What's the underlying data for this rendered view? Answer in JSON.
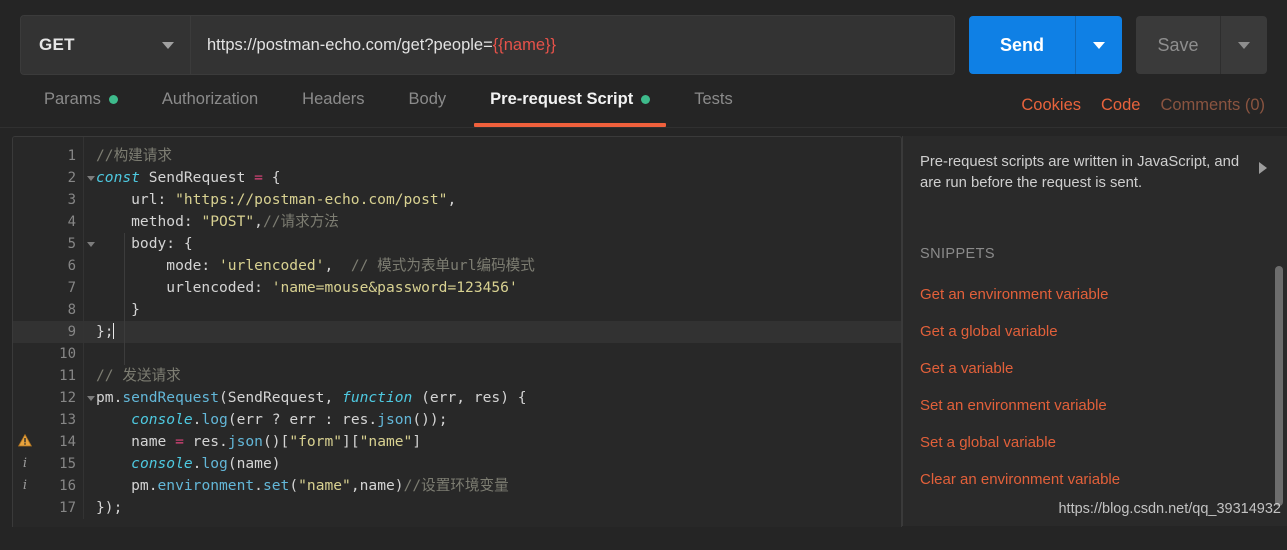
{
  "request": {
    "method": "GET",
    "url_prefix": "https://postman-echo.com/get?people=",
    "url_variable": "{{name}}",
    "send_label": "Send",
    "save_label": "Save"
  },
  "tabs": [
    {
      "label": "Params",
      "dot": true,
      "active": false
    },
    {
      "label": "Authorization",
      "dot": false,
      "active": false
    },
    {
      "label": "Headers",
      "dot": false,
      "active": false
    },
    {
      "label": "Body",
      "dot": false,
      "active": false
    },
    {
      "label": "Pre-request Script",
      "dot": true,
      "active": true
    },
    {
      "label": "Tests",
      "dot": false,
      "active": false
    }
  ],
  "tab_actions": [
    {
      "label": "Cookies",
      "muted": false
    },
    {
      "label": "Code",
      "muted": false
    },
    {
      "label": "Comments (0)",
      "muted": true
    }
  ],
  "editor": {
    "lines": [
      {
        "n": "1",
        "marker": "",
        "fold": false,
        "current": false
      },
      {
        "n": "2",
        "marker": "",
        "fold": true,
        "current": false
      },
      {
        "n": "3",
        "marker": "",
        "fold": false,
        "current": false
      },
      {
        "n": "4",
        "marker": "",
        "fold": false,
        "current": false
      },
      {
        "n": "5",
        "marker": "",
        "fold": true,
        "current": false
      },
      {
        "n": "6",
        "marker": "",
        "fold": false,
        "current": false
      },
      {
        "n": "7",
        "marker": "",
        "fold": false,
        "current": false
      },
      {
        "n": "8",
        "marker": "",
        "fold": false,
        "current": false
      },
      {
        "n": "9",
        "marker": "",
        "fold": false,
        "current": true
      },
      {
        "n": "10",
        "marker": "",
        "fold": false,
        "current": false
      },
      {
        "n": "11",
        "marker": "",
        "fold": false,
        "current": false
      },
      {
        "n": "12",
        "marker": "",
        "fold": true,
        "current": false
      },
      {
        "n": "13",
        "marker": "",
        "fold": false,
        "current": false
      },
      {
        "n": "14",
        "marker": "warning",
        "fold": false,
        "current": false
      },
      {
        "n": "15",
        "marker": "info",
        "fold": false,
        "current": false
      },
      {
        "n": "16",
        "marker": "info",
        "fold": false,
        "current": false
      },
      {
        "n": "17",
        "marker": "",
        "fold": false,
        "current": false
      }
    ],
    "code_text": [
      "//构建请求",
      "const SendRequest = {",
      "    url: \"https://postman-echo.com/post\",",
      "    method: \"POST\",//请求方法",
      "    body: {",
      "        mode: 'urlencoded',  // 模式为表单url编码模式",
      "        urlencoded: 'name=mouse&password=123456'",
      "    }",
      "};",
      "",
      "// 发送请求",
      "pm.sendRequest(SendRequest, function (err, res) {",
      "    console.log(err ? err : res.json());",
      "    name = res.json()[\"form\"][\"name\"]",
      "    console.log(name)",
      "    pm.environment.set(\"name\",name)//设置环境变量",
      "});"
    ]
  },
  "side_panel": {
    "description": "Pre-request scripts are written in JavaScript, and are run before the request is sent.",
    "snippets_heading": "SNIPPETS",
    "snippets": [
      "Get an environment variable",
      "Get a global variable",
      "Get a variable",
      "Set an environment variable",
      "Set a global variable",
      "Clear an environment variable"
    ]
  },
  "watermark": "https://blog.csdn.net/qq_39314932",
  "colors": {
    "accent_orange": "#f0603c",
    "send_blue": "#0f80e5",
    "dot_green": "#3ebb8c",
    "warning": "#e8a33d",
    "string": "#d8d191",
    "keyword": "#4ec9e0",
    "comment": "#7d7d72",
    "operator": "#e0457b"
  }
}
